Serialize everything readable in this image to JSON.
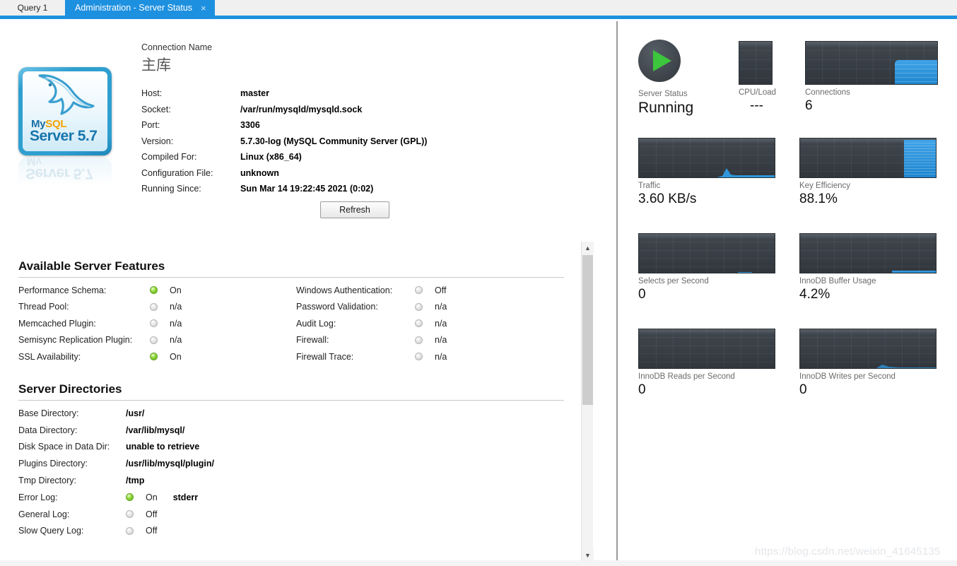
{
  "window": {
    "tabs": [
      {
        "label": "Query 1",
        "active": false
      },
      {
        "label": "Administration - Server Status",
        "active": true,
        "close_glyph": "×"
      }
    ]
  },
  "logo": {
    "product": "MySQL",
    "my": "My",
    "sql": "SQL",
    "server_line": "Server 5.7",
    "icon": "mysql-dolphin-icon"
  },
  "connection": {
    "caption": "Connection Name",
    "name": "主库",
    "rows": [
      {
        "label": "Host:",
        "value": "master"
      },
      {
        "label": "Socket:",
        "value": "/var/run/mysqld/mysqld.sock"
      },
      {
        "label": "Port:",
        "value": "3306"
      },
      {
        "label": "Version:",
        "value": "5.7.30-log (MySQL Community Server (GPL))"
      },
      {
        "label": "Compiled For:",
        "value": "Linux   (x86_64)"
      },
      {
        "label": "Configuration File:",
        "value": "unknown"
      },
      {
        "label": "Running Since:",
        "value": "Sun Mar 14 19:22:45 2021 (0:02)"
      }
    ],
    "refresh_label": "Refresh"
  },
  "features": {
    "title": "Available Server Features",
    "left": [
      {
        "label": "Performance Schema:",
        "state": "On",
        "led": "on"
      },
      {
        "label": "Thread Pool:",
        "state": "n/a",
        "led": "off"
      },
      {
        "label": "Memcached Plugin:",
        "state": "n/a",
        "led": "off"
      },
      {
        "label": "Semisync Replication Plugin:",
        "state": "n/a",
        "led": "off"
      },
      {
        "label": "SSL Availability:",
        "state": "On",
        "led": "on"
      }
    ],
    "right": [
      {
        "label": "Windows Authentication:",
        "state": "Off",
        "led": "off"
      },
      {
        "label": "Password Validation:",
        "state": "n/a",
        "led": "off"
      },
      {
        "label": "Audit Log:",
        "state": "n/a",
        "led": "off"
      },
      {
        "label": "Firewall:",
        "state": "n/a",
        "led": "off"
      },
      {
        "label": "Firewall Trace:",
        "state": "n/a",
        "led": "off"
      }
    ]
  },
  "directories": {
    "title": "Server Directories",
    "rows": [
      {
        "label": "Base Directory:",
        "value": "/usr/"
      },
      {
        "label": "Data Directory:",
        "value": "/var/lib/mysql/"
      },
      {
        "label": "Disk Space in Data Dir:",
        "value": "unable to retrieve"
      },
      {
        "label": "Plugins Directory:",
        "value": "/usr/lib/mysql/plugin/"
      },
      {
        "label": "Tmp Directory:",
        "value": "/tmp"
      },
      {
        "label": "Error Log:",
        "state": "On",
        "led": "on",
        "extra": "stderr"
      },
      {
        "label": "General Log:",
        "state": "Off",
        "led": "off"
      },
      {
        "label": "Slow Query Log:",
        "state": "Off",
        "led": "off"
      }
    ]
  },
  "dashboard": {
    "server_status": {
      "label": "Server Status",
      "value": "Running",
      "icon": "play-icon"
    },
    "cpu_load": {
      "label": "CPU/Load",
      "value": "---"
    },
    "connections": {
      "label": "Connections",
      "value": "6"
    },
    "traffic": {
      "label": "Traffic",
      "value": "3.60 KB/s"
    },
    "key_efficiency": {
      "label": "Key Efficiency",
      "value": "88.1%"
    },
    "selects": {
      "label": "Selects per Second",
      "value": "0"
    },
    "innodb_buffer": {
      "label": "InnoDB Buffer Usage",
      "value": "4.2%"
    },
    "innodb_reads": {
      "label": "InnoDB Reads per Second",
      "value": "0"
    },
    "innodb_writes": {
      "label": "InnoDB Writes per Second",
      "value": "0"
    }
  },
  "colors": {
    "accent_blue": "#1e90e0",
    "graph_fill": "#2f96db",
    "led_on": "#76c430",
    "play_green": "#3cc63c",
    "graph_bg": "#383e45"
  },
  "watermark": {
    "text": "https://blog.csdn.net/weixin_41645135"
  },
  "chart_data": [
    {
      "type": "area",
      "title": "CPU/Load",
      "values": [
        0,
        0,
        0,
        0,
        0,
        0,
        0,
        0
      ],
      "ylim": [
        0,
        100
      ],
      "unit": "%"
    },
    {
      "type": "area",
      "title": "Connections",
      "values": [
        0,
        0,
        0,
        0,
        0,
        0,
        0,
        0,
        0,
        0,
        55,
        55,
        55
      ],
      "ylim": [
        0,
        100
      ],
      "unit": "count"
    },
    {
      "type": "area",
      "title": "Traffic",
      "values": [
        0,
        0,
        0,
        0,
        0,
        0,
        0,
        0,
        0,
        0,
        0,
        18,
        5,
        5,
        5
      ],
      "ylim": [
        0,
        100
      ],
      "unit": "KB/s"
    },
    {
      "type": "area",
      "title": "Key Efficiency",
      "values": [
        0,
        0,
        0,
        0,
        0,
        0,
        0,
        0,
        0,
        0,
        0,
        88,
        88,
        88,
        88
      ],
      "ylim": [
        0,
        100
      ],
      "unit": "%"
    },
    {
      "type": "area",
      "title": "Selects per Second",
      "values": [
        0,
        0,
        0,
        0,
        0,
        0,
        0,
        0,
        0,
        0,
        0,
        0,
        1,
        0
      ],
      "ylim": [
        0,
        100
      ],
      "unit": "ops"
    },
    {
      "type": "area",
      "title": "InnoDB Buffer Usage",
      "values": [
        0,
        0,
        0,
        0,
        0,
        0,
        0,
        0,
        0,
        0,
        4,
        4,
        4,
        4
      ],
      "ylim": [
        0,
        100
      ],
      "unit": "%"
    },
    {
      "type": "area",
      "title": "InnoDB Reads per Second",
      "values": [
        0,
        0,
        0,
        0,
        0,
        0,
        0,
        0,
        0,
        0,
        0,
        0,
        0,
        0
      ],
      "ylim": [
        0,
        100
      ],
      "unit": "ops"
    },
    {
      "type": "area",
      "title": "InnoDB Writes per Second",
      "values": [
        0,
        0,
        0,
        0,
        0,
        0,
        0,
        0,
        0,
        0,
        0,
        0,
        3,
        1,
        1
      ],
      "ylim": [
        0,
        100
      ],
      "unit": "ops"
    }
  ]
}
